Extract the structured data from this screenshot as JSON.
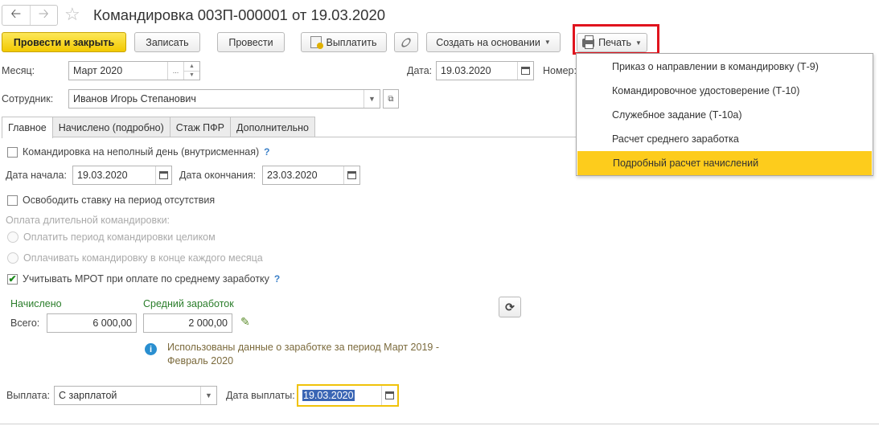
{
  "header": {
    "back_icon": "arrow-left-icon",
    "forward_icon": "arrow-right-icon",
    "favorite_icon": "star-icon",
    "title": "Командировка 003П-000001 от 19.03.2020"
  },
  "toolbar": {
    "post_and_close": "Провести и закрыть",
    "save": "Записать",
    "post": "Провести",
    "pay": "Выплатить",
    "create_based_on": "Создать на основании",
    "print": "Печать"
  },
  "print_menu": {
    "items": [
      "Приказ о направлении в командировку (Т-9)",
      "Командировочное удостоверение (Т-10)",
      "Служебное задание (Т-10а)",
      "Расчет среднего заработка",
      "Подробный расчет начислений"
    ],
    "highlighted_index": 4
  },
  "fields": {
    "month_label": "Месяц:",
    "month_value": "Март 2020",
    "date_label": "Дата:",
    "date_value": "19.03.2020",
    "number_label": "Номер:",
    "employee_label": "Сотрудник:",
    "employee_value": "Иванов Игорь Степанович"
  },
  "tabs": [
    "Главное",
    "Начислено (подробно)",
    "Стаж ПФР",
    "Дополнительно"
  ],
  "main": {
    "partial_day_label": "Командировка на неполный день (внутрисменная)",
    "partial_day_checked": false,
    "start_label": "Дата начала:",
    "start_value": "19.03.2020",
    "end_label": "Дата окончания:",
    "end_value": "23.03.2020",
    "free_rate_label": "Освободить ставку на период отсутствия",
    "free_rate_checked": false,
    "long_trip_label": "Оплата длительной командировки:",
    "radio_whole": "Оплатить период командировки целиком",
    "radio_monthly": "Оплачивать командировку в конце каждого месяца",
    "mrot_label": "Учитывать МРОТ при оплате по среднему заработку",
    "mrot_checked": true,
    "help_mark": "?",
    "accrued_header": "Начислено",
    "total_label": "Всего:",
    "total_value": "6 000,00",
    "avg_header": "Средний заработок",
    "avg_value": "2 000,00",
    "info_text_1": "Использованы данные о заработке за период Март 2019 -",
    "info_text_2": "Февраль 2020",
    "payout_label": "Выплата:",
    "payout_value": "С зарплатой",
    "payout_date_label": "Дата выплаты:",
    "payout_date_value": "19.03.2020"
  },
  "colors": {
    "primary_button": "#f2c900",
    "menu_highlight": "#fdcc1c",
    "print_outline": "#e0141e",
    "green_header": "#2a7d2a"
  }
}
